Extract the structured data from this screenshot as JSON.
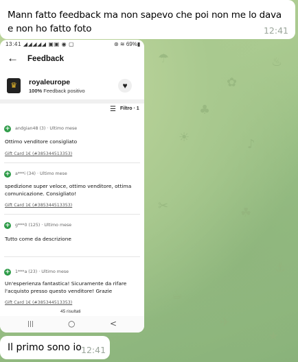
{
  "messages": [
    {
      "text": "Mann fatto feedback ma non sapevo che poi non me lo dava e non ho fatto foto",
      "time": "12:41"
    },
    {
      "text": "Il primo sono io",
      "time": "12:41"
    }
  ],
  "screenshot": {
    "status_left": "13:41 ◢◢◢◢◢ ▣▣ ◉ ▢",
    "status_right": "⊛ ≋ 69%▮",
    "header": {
      "back_icon": "back-arrow-icon",
      "title": "Feedback"
    },
    "seller": {
      "name": "royaleurope",
      "positive_percent": "100%",
      "positive_label": "Feedback positivo"
    },
    "filter_label": "Filtro · 1",
    "reviews": [
      {
        "meta": "andgian48 (3) · Ultimo mese",
        "text": "Ottimo venditore consigliato",
        "item": "Gift Card 1€ (#385344513353)"
      },
      {
        "meta": "a***i (34) · Ultimo mese",
        "text": "spedizione super veloce, ottimo venditore, ottima comunicazione. Consigliato!",
        "item": "Gift Card 1€ (#385344513353)"
      },
      {
        "meta": "g***0 (125) · Ultimo mese",
        "text": "Tutto come da descrizione",
        "item": ""
      },
      {
        "meta": "1***a (23) · Ultimo mese",
        "text": "Un'esperienza fantastica! Sicuramente da rifare l'acquisto presso questo venditore! Grazie",
        "item": "Gift Card 1€ (#385344513353)"
      }
    ],
    "results": "45 risultati",
    "nav": {
      "recent": "|||",
      "home": "○",
      "back": "<"
    }
  },
  "colors": {
    "chat_bg": "#a9c98f",
    "bubble": "#ffffff",
    "timestamp": "#9aa59a",
    "plus_badge": "#2e9b48"
  }
}
